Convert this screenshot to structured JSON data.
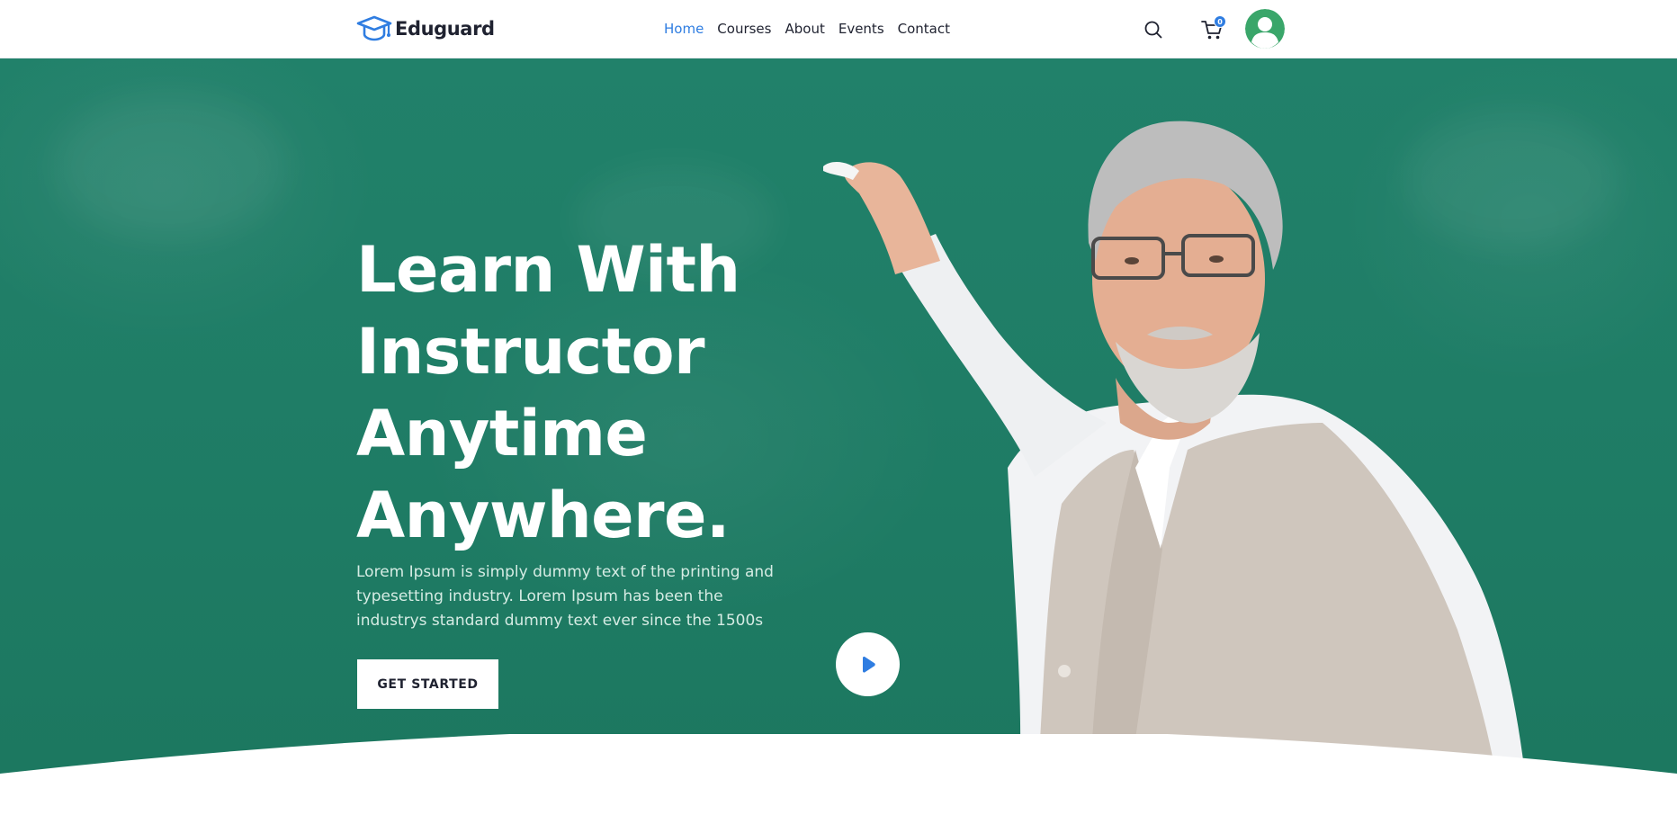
{
  "header": {
    "brand": "Eduguard",
    "brand_icon": "graduation-cap-icon",
    "nav": [
      {
        "label": "Home",
        "active": true
      },
      {
        "label": "Courses",
        "active": false
      },
      {
        "label": "About",
        "active": false
      },
      {
        "label": "Events",
        "active": false
      },
      {
        "label": "Contact",
        "active": false
      }
    ],
    "search_icon": "search-icon",
    "cart_icon": "cart-icon",
    "cart_count": "0",
    "avatar_icon": "user-avatar-icon"
  },
  "hero": {
    "title_lines": [
      "Learn With",
      "Instructor",
      "Anytime",
      "Anywhere."
    ],
    "description": "Lorem Ipsum is simply dummy text of the printing and typesetting industry. Lorem Ipsum has been the industrys standard dummy text ever since the 1500s",
    "cta_label": "GET STARTED",
    "play_icon": "play-icon",
    "image": "teacher-at-chalkboard"
  },
  "colors": {
    "accent": "#2f7de1",
    "hero_green": "#1f7d66",
    "avatar_green": "#3aa66a",
    "text_dark": "#1f2230"
  }
}
